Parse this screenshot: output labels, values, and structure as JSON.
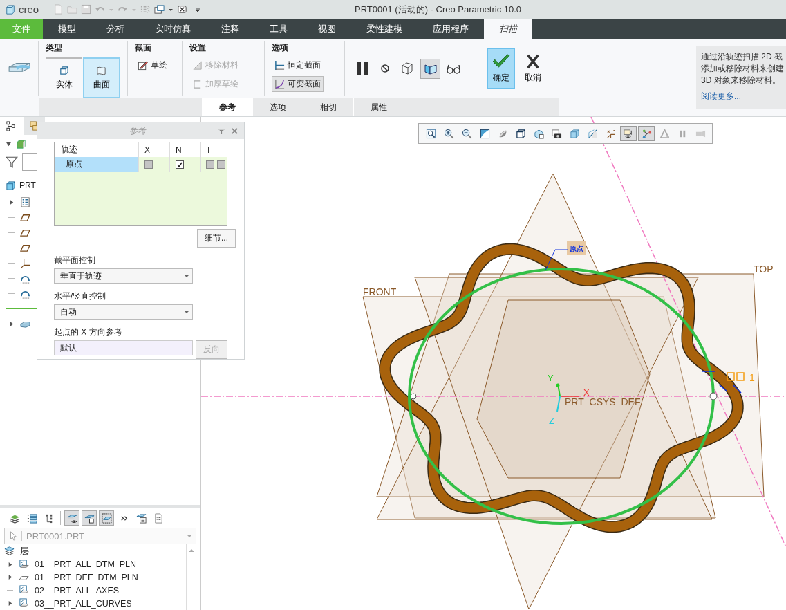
{
  "app": {
    "logo": "creo",
    "title": "PRT0001 (活动的) - Creo Parametric 10.0"
  },
  "menu_tabs": [
    {
      "label": "文件",
      "kind": "file",
      "selected": false
    },
    {
      "label": "模型",
      "kind": "tab",
      "selected": false
    },
    {
      "label": "分析",
      "kind": "tab",
      "selected": false
    },
    {
      "label": "实时仿真",
      "kind": "tab",
      "selected": false
    },
    {
      "label": "注释",
      "kind": "tab",
      "selected": false
    },
    {
      "label": "工具",
      "kind": "tab",
      "selected": false
    },
    {
      "label": "视图",
      "kind": "tab",
      "selected": false
    },
    {
      "label": "柔性建模",
      "kind": "tab",
      "selected": false
    },
    {
      "label": "应用程序",
      "kind": "tab",
      "selected": false
    },
    {
      "label": "扫描",
      "kind": "tab",
      "selected": true
    }
  ],
  "ribbon": {
    "type_group": {
      "title": "类型",
      "options": [
        {
          "label": "实体",
          "selected": false
        },
        {
          "label": "曲面",
          "selected": true
        }
      ]
    },
    "section_group": {
      "title": "截面",
      "button": "草绘"
    },
    "settings_group": {
      "title": "设置",
      "options": [
        {
          "label": "移除材料",
          "disabled": true
        },
        {
          "label": "加厚草绘",
          "disabled": true
        }
      ]
    },
    "options_group": {
      "title": "选项",
      "options": [
        {
          "label": "恒定截面",
          "selected": false
        },
        {
          "label": "可变截面",
          "selected": true
        }
      ]
    },
    "preview_tools": [
      {
        "selected": false
      },
      {
        "selected": false
      },
      {
        "selected": false
      },
      {
        "selected": true
      },
      {
        "selected": false
      }
    ],
    "ok_button": {
      "label": "确定",
      "selected": true
    },
    "cancel_button": {
      "label": "取消"
    },
    "sub_tabs": [
      {
        "label": "参考",
        "selected": true
      },
      {
        "label": "选项",
        "selected": false
      },
      {
        "label": "相切",
        "selected": false
      },
      {
        "label": "属性",
        "selected": false
      }
    ],
    "help": {
      "lines": [
        "通过沿轨迹扫描 2D 截",
        "添加或移除材料来创建",
        "3D 对象来移除材料。"
      ],
      "link": "阅读更多..."
    }
  },
  "model_tree": {
    "root": "PRT",
    "items": [
      {
        "kind": "notes",
        "collapsed": true
      },
      {
        "kind": "plane",
        "collapsed": false
      },
      {
        "kind": "plane",
        "collapsed": false
      },
      {
        "kind": "plane",
        "collapsed": false
      },
      {
        "kind": "csys",
        "collapsed": false
      },
      {
        "kind": "curve",
        "collapsed": false
      },
      {
        "kind": "curve",
        "collapsed": false
      },
      {
        "kind": "insert",
        "collapsed": false
      },
      {
        "kind": "surface",
        "collapsed": true
      }
    ]
  },
  "reference_panel": {
    "title": "参考",
    "columns": [
      "轨迹",
      "X",
      "N",
      "T"
    ],
    "rows": [
      {
        "name": "原点",
        "selected": true,
        "x": false,
        "n": true,
        "t": [
          false,
          false
        ]
      }
    ],
    "details_button": "细节...",
    "section_control": {
      "label": "截平面控制",
      "value": "垂直于轨迹"
    },
    "orientation_control": {
      "label": "水平/竖直控制",
      "value": "自动"
    },
    "x_reference": {
      "label": "起点的 X 方向参考",
      "value": "默认"
    },
    "flip_button": {
      "label": "反向",
      "disabled": true
    }
  },
  "layers": {
    "toolbar": [
      {
        "selected": false
      },
      {
        "selected": false
      },
      {
        "selected": false
      },
      {
        "selected": true
      },
      {
        "selected": true
      },
      {
        "selected": true
      },
      {
        "selected": false
      },
      {
        "selected": false
      },
      {
        "selected": false
      }
    ],
    "model": "PRT0001.PRT",
    "header": "层",
    "items": [
      {
        "label": "01__PRT_ALL_DTM_PLN",
        "kind": "layer",
        "collapsed": true
      },
      {
        "label": "01__PRT_DEF_DTM_PLN",
        "kind": "plane",
        "collapsed": true
      },
      {
        "label": "02__PRT_ALL_AXES",
        "kind": "layer",
        "collapsed": false
      },
      {
        "label": "03__PRT_ALL_CURVES",
        "kind": "layer",
        "collapsed": true
      }
    ]
  },
  "view_toolbar": [
    {
      "selected": false
    },
    {
      "selected": false
    },
    {
      "selected": false
    },
    {
      "selected": false
    },
    {
      "selected": false
    },
    {
      "selected": false
    },
    {
      "selected": false
    },
    {
      "selected": false
    },
    {
      "selected": false
    },
    {
      "selected": false
    },
    {
      "selected": false
    },
    {
      "selected": true
    },
    {
      "selected": true
    },
    {
      "selected": false
    },
    {
      "selected": false
    },
    {
      "selected": false
    }
  ],
  "graphics": {
    "planes": [
      "FRONT",
      "TOP"
    ],
    "csys": {
      "name": "PRT_CSYS_DEF",
      "axes": [
        "X",
        "Y",
        "Z"
      ]
    },
    "start_label": "原点",
    "section_label": "1"
  }
}
